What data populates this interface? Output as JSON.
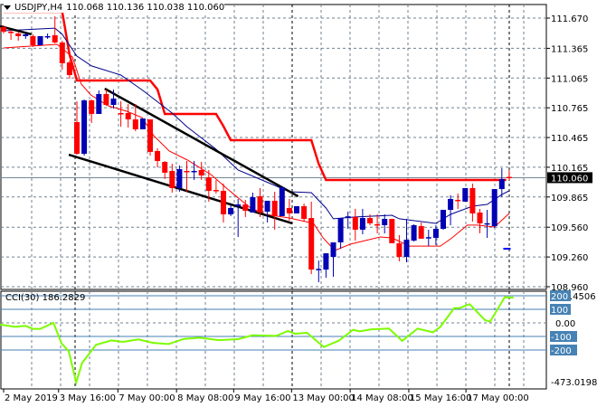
{
  "header": {
    "symbol": "USDJPY,H4",
    "ohlc": "110.068 110.136 110.038 110.060"
  },
  "colors": {
    "bull": "#0000b4",
    "bear": "#ff0000",
    "grid": "#708090",
    "ma_blue": "#00008b",
    "ma_red": "#ff0000",
    "cci": "#7cfc00",
    "level_box": "#4682b4"
  },
  "chart_data": [
    {
      "type": "candlestick",
      "title": "USDJPY,H4",
      "ylim": [
        108.96,
        111.735
      ],
      "yticks": [
        "111.670",
        "111.365",
        "111.065",
        "110.765",
        "110.465",
        "110.165",
        "109.865",
        "109.560",
        "109.260",
        "108.960"
      ],
      "current_price": "110.060",
      "xticks": [
        {
          "label": "2 May 2019",
          "bar": 0
        },
        {
          "label": "3 May 16:00",
          "bar": 7.5
        },
        {
          "label": "7 May 00:00",
          "bar": 15.6
        },
        {
          "label": "8 May 08:00",
          "bar": 23.6
        },
        {
          "label": "9 May 16:00",
          "bar": 31.4
        },
        {
          "label": "13 May 00:00",
          "bar": 39.3
        },
        {
          "label": "14 May 08:00",
          "bar": 47.3
        },
        {
          "label": "15 May 16:00",
          "bar": 55.3
        },
        {
          "label": "17 May 00:00",
          "bar": 63.1
        }
      ],
      "candles_ohlc": [
        [
          111.579,
          111.597,
          111.515,
          111.533
        ],
        [
          111.533,
          111.551,
          111.451,
          111.524
        ],
        [
          111.515,
          111.533,
          111.442,
          111.488
        ],
        [
          111.488,
          111.515,
          111.46,
          111.506
        ],
        [
          111.488,
          111.506,
          111.378,
          111.396
        ],
        [
          111.396,
          111.488,
          111.396,
          111.488
        ],
        [
          111.478,
          111.515,
          111.46,
          111.488
        ],
        [
          111.497,
          111.688,
          111.415,
          111.424
        ],
        [
          111.424,
          111.442,
          111.15,
          111.214
        ],
        [
          111.223,
          111.241,
          111.059,
          111.095
        ],
        [
          110.621,
          110.831,
          110.292,
          110.301
        ],
        [
          110.301,
          110.849,
          110.283,
          110.84
        ],
        [
          110.84,
          110.849,
          110.612,
          110.703
        ],
        [
          110.703,
          110.94,
          110.703,
          110.904
        ],
        [
          110.904,
          110.949,
          110.785,
          110.794
        ],
        [
          110.794,
          110.949,
          110.758,
          110.858
        ],
        [
          110.712,
          110.831,
          110.575,
          110.703
        ],
        [
          110.712,
          110.803,
          110.566,
          110.648
        ],
        [
          110.648,
          110.803,
          110.529,
          110.548
        ],
        [
          110.548,
          110.657,
          110.548,
          110.657
        ],
        [
          110.648,
          110.648,
          110.283,
          110.32
        ],
        [
          110.329,
          110.356,
          110.164,
          110.228
        ],
        [
          110.219,
          110.228,
          110.046,
          110.11
        ],
        [
          110.128,
          110.201,
          109.909,
          109.955
        ],
        [
          109.955,
          110.183,
          109.918,
          110.146
        ],
        [
          110.128,
          110.228,
          109.918,
          110.12
        ],
        [
          110.12,
          110.228,
          110.037,
          110.128
        ],
        [
          110.137,
          110.219,
          110.037,
          110.082
        ],
        [
          110.064,
          110.137,
          109.818,
          109.927
        ],
        [
          109.936,
          110.037,
          109.9,
          109.927
        ],
        [
          109.927,
          110.0,
          109.608,
          109.69
        ],
        [
          109.69,
          109.781,
          109.672,
          109.754
        ],
        [
          109.772,
          109.845,
          109.462,
          109.79
        ],
        [
          109.79,
          109.836,
          109.663,
          109.726
        ],
        [
          109.708,
          109.909,
          109.708,
          109.863
        ],
        [
          109.872,
          109.955,
          109.663,
          109.708
        ],
        [
          109.717,
          109.827,
          109.608,
          109.827
        ],
        [
          109.827,
          109.918,
          109.535,
          109.672
        ],
        [
          109.672,
          109.964,
          109.672,
          109.964
        ],
        [
          109.754,
          109.845,
          109.627,
          109.699
        ],
        [
          109.699,
          109.772,
          109.699,
          109.772
        ],
        [
          109.772,
          109.799,
          109.617,
          109.644
        ],
        [
          109.653,
          109.818,
          109.087,
          109.133
        ],
        [
          109.133,
          109.224,
          109.005,
          109.14
        ],
        [
          109.133,
          109.297,
          109.05,
          109.297
        ],
        [
          109.261,
          109.343,
          109.06,
          109.407
        ],
        [
          109.407,
          109.617,
          109.343,
          109.653
        ],
        [
          109.663,
          109.717,
          109.544,
          109.67
        ],
        [
          109.663,
          109.745,
          109.425,
          109.535
        ],
        [
          109.535,
          109.745,
          109.489,
          109.653
        ],
        [
          109.653,
          109.69,
          109.58,
          109.599
        ],
        [
          109.59,
          109.69,
          109.498,
          109.585
        ],
        [
          109.581,
          109.69,
          109.498,
          109.644
        ],
        [
          109.644,
          109.644,
          109.398,
          109.398
        ],
        [
          109.398,
          109.48,
          109.216,
          109.261
        ],
        [
          109.261,
          109.644,
          109.206,
          109.434
        ],
        [
          109.425,
          109.589,
          109.416,
          109.581
        ],
        [
          109.571,
          109.608,
          109.444,
          109.444
        ],
        [
          109.453,
          109.535,
          109.37,
          109.46
        ],
        [
          109.453,
          109.58,
          109.38,
          109.544
        ],
        [
          109.544,
          109.735,
          109.535,
          109.735
        ],
        [
          109.735,
          109.883,
          109.58,
          109.845
        ],
        [
          109.836,
          109.9,
          109.745,
          109.827
        ],
        [
          109.818,
          109.873,
          109.818,
          109.955
        ],
        [
          109.955,
          110.0,
          109.617,
          109.699
        ],
        [
          109.708,
          109.745,
          109.498,
          109.599
        ],
        [
          109.59,
          109.735,
          109.452,
          109.6
        ],
        [
          109.571,
          109.945,
          109.553,
          109.945
        ],
        [
          109.945,
          110.155,
          109.866,
          110.046
        ],
        [
          110.068,
          110.136,
          110.038,
          110.06
        ]
      ],
      "upper_channel": [
        [
          0,
          111.734
        ],
        [
          8,
          111.734
        ],
        [
          9,
          111.3
        ],
        [
          10,
          111.04
        ],
        [
          20,
          111.04
        ],
        [
          21,
          110.95
        ],
        [
          22,
          110.703
        ],
        [
          29,
          110.703
        ],
        [
          30,
          110.58
        ],
        [
          31,
          110.438
        ],
        [
          42,
          110.438
        ],
        [
          43,
          110.2
        ],
        [
          44,
          110.037
        ],
        [
          68.6,
          110.037
        ]
      ],
      "ma_blue": [
        [
          0,
          111.542
        ],
        [
          7,
          111.569
        ],
        [
          8,
          111.506
        ],
        [
          10,
          111.287
        ],
        [
          12,
          111.187
        ],
        [
          16,
          111.095
        ],
        [
          19,
          110.94
        ],
        [
          23,
          110.712
        ],
        [
          25,
          110.575
        ],
        [
          29,
          110.347
        ],
        [
          32,
          110.137
        ],
        [
          37,
          109.982
        ],
        [
          39,
          109.918
        ],
        [
          42,
          109.909
        ],
        [
          44,
          109.754
        ],
        [
          45,
          109.645
        ],
        [
          48,
          109.663
        ],
        [
          53,
          109.681
        ],
        [
          54,
          109.645
        ],
        [
          59,
          109.599
        ],
        [
          61,
          109.69
        ],
        [
          64,
          109.772
        ],
        [
          66,
          109.79
        ],
        [
          68,
          109.89
        ],
        [
          69,
          109.927
        ]
      ],
      "ma_red": [
        [
          0,
          111.369
        ],
        [
          7.3,
          111.405
        ],
        [
          9.4,
          111.278
        ],
        [
          10.6,
          111.004
        ],
        [
          11.9,
          110.894
        ],
        [
          14.3,
          110.785
        ],
        [
          16.8,
          110.73
        ],
        [
          18.9,
          110.666
        ],
        [
          20.5,
          110.484
        ],
        [
          22.6,
          110.329
        ],
        [
          25.1,
          110.237
        ],
        [
          28.3,
          110.091
        ],
        [
          30.7,
          109.936
        ],
        [
          33.7,
          109.754
        ],
        [
          35.7,
          109.69
        ],
        [
          39,
          109.653
        ],
        [
          42.3,
          109.599
        ],
        [
          43.6,
          109.453
        ],
        [
          45.2,
          109.325
        ],
        [
          47.3,
          109.389
        ],
        [
          51.4,
          109.462
        ],
        [
          53,
          109.453
        ],
        [
          55.4,
          109.37
        ],
        [
          59.6,
          109.37
        ],
        [
          61.2,
          109.453
        ],
        [
          63.3,
          109.581
        ],
        [
          64.6,
          109.581
        ],
        [
          67,
          109.562
        ],
        [
          69,
          109.699
        ]
      ],
      "trendlines": [
        [
          [
            -0.5,
            111.588
          ],
          [
            3.8,
            111.506
          ]
        ],
        [
          [
            13.8,
            110.958
          ],
          [
            40.2,
            109.872
          ]
        ],
        [
          [
            8.9,
            110.292
          ],
          [
            39.4,
            109.599
          ]
        ]
      ],
      "marker": [
        [
          68.2,
          109.343
        ],
        [
          69.2,
          109.343
        ]
      ],
      "period_separators": [
        9.7,
        39.4,
        69
      ]
    },
    {
      "type": "line",
      "title": "CCI(30)",
      "last_value": "186.2829",
      "ylim": [
        -473.0198,
        225.4506
      ],
      "max_label": "225.4506",
      "min_label": "-473.0198",
      "zero_label": "0.00",
      "levels": [
        {
          "value": 200,
          "label": "200"
        },
        {
          "value": 100,
          "label": "100"
        },
        {
          "value": -100,
          "label": "-100"
        },
        {
          "value": -200,
          "label": "-200"
        }
      ],
      "points": [
        [
          -0.5,
          -13
        ],
        [
          1.6,
          -29
        ],
        [
          3,
          -22
        ],
        [
          4,
          -44
        ],
        [
          5,
          -44
        ],
        [
          6.8,
          0
        ],
        [
          7.9,
          -151
        ],
        [
          8.9,
          -211
        ],
        [
          9.9,
          -440
        ],
        [
          10.7,
          -296
        ],
        [
          12.6,
          -162
        ],
        [
          14.7,
          -129
        ],
        [
          16.3,
          -140
        ],
        [
          18.4,
          -122
        ],
        [
          20.4,
          -147
        ],
        [
          22.5,
          -156
        ],
        [
          24.6,
          -118
        ],
        [
          26.7,
          -109
        ],
        [
          29.4,
          -127
        ],
        [
          32,
          -120
        ],
        [
          34,
          -91
        ],
        [
          37.2,
          -96
        ],
        [
          38.8,
          -60
        ],
        [
          39.8,
          -80
        ],
        [
          41.4,
          -73
        ],
        [
          43.7,
          -178
        ],
        [
          45.8,
          -129
        ],
        [
          47.7,
          -51
        ],
        [
          48.6,
          -62
        ],
        [
          50.2,
          -47
        ],
        [
          52.6,
          -42
        ],
        [
          54.4,
          -133
        ],
        [
          56.5,
          -42
        ],
        [
          58.6,
          -69
        ],
        [
          59.6,
          -29
        ],
        [
          61.5,
          109
        ],
        [
          62.2,
          109
        ],
        [
          63.6,
          138
        ],
        [
          65.7,
          20
        ],
        [
          66.4,
          9
        ],
        [
          68.4,
          189
        ],
        [
          69.6,
          186
        ]
      ]
    }
  ]
}
